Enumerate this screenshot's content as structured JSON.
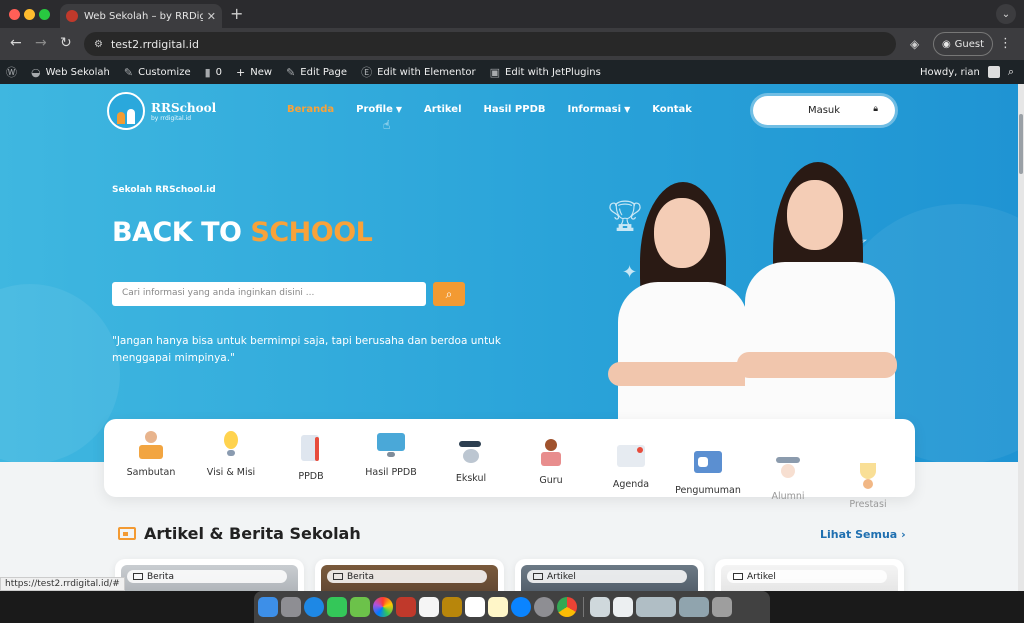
{
  "browser": {
    "tab_title": "Web Sekolah – by RRDigital.id",
    "tab_close": "✕",
    "new_tab": "+",
    "url": "test2.rrdigital.id",
    "profile_label": "Guest"
  },
  "wp_admin": {
    "site_name": "Web Sekolah",
    "customize": "Customize",
    "comments_count": "0",
    "new_label": "New",
    "edit_page": "Edit Page",
    "edit_elementor": "Edit with Elementor",
    "edit_jetplugins": "Edit with JetPlugins",
    "howdy": "Howdy, rian"
  },
  "site": {
    "logo_name": "RRSchool",
    "logo_sub": "by rrdigital.id",
    "menu": [
      {
        "label": "Beranda",
        "active": true
      },
      {
        "label": "Profile",
        "has_caret": true
      },
      {
        "label": "Artikel"
      },
      {
        "label": "Hasil PPDB"
      },
      {
        "label": "Informasi",
        "has_caret": true
      },
      {
        "label": "Kontak"
      }
    ],
    "login_label": "Masuk"
  },
  "hero": {
    "kicker": "Sekolah RRSchool.id",
    "headline_white": "BACK TO",
    "headline_accent": "SCHOOL",
    "search_placeholder": "Cari informasi yang anda inginkan disini ...",
    "quote": "\"Jangan hanya bisa untuk bermimpi saja, tapi berusaha dan berdoa untuk menggapai mimpinya.\""
  },
  "quick_links": [
    {
      "label": "Sambutan"
    },
    {
      "label": "Visi & Misi"
    },
    {
      "label": "PPDB"
    },
    {
      "label": "Hasil PPDB"
    },
    {
      "label": "Ekskul"
    },
    {
      "label": "Guru"
    },
    {
      "label": "Agenda"
    },
    {
      "label": "Pengumuman"
    },
    {
      "label": "Alumni"
    },
    {
      "label": "Prestasi"
    }
  ],
  "articles": {
    "section_title": "Artikel & Berita Sekolah",
    "see_all": "Lihat Semua",
    "cards": [
      {
        "badge": "Berita"
      },
      {
        "badge": "Berita"
      },
      {
        "badge": "Artikel"
      },
      {
        "badge": "Artikel"
      }
    ]
  },
  "status_url": "https://test2.rrdigital.id/#",
  "colors": {
    "accent": "#f8a23a",
    "hero_blue": "#2aa3d9",
    "link_blue": "#1f6fb0"
  }
}
